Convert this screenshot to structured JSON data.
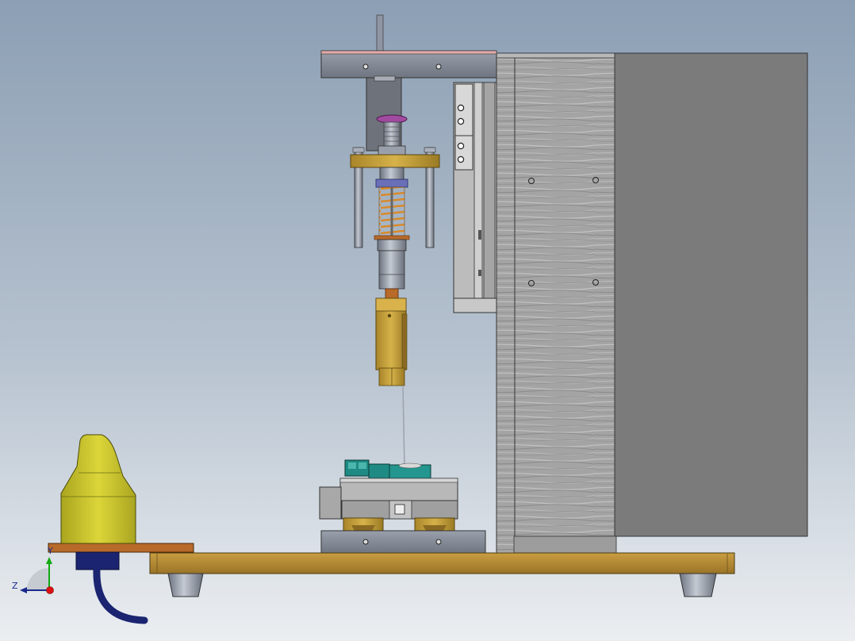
{
  "triad": {
    "y_label": "Y",
    "z_label": "Z"
  },
  "colors": {
    "background_top": "#8c9fb4",
    "background_bottom": "#ebeef1",
    "wood": "#b8903a",
    "wood_dark": "#8a6a22",
    "brass": "#c9a23a",
    "steel": "#8f96a3",
    "steel_dark": "#5f6570",
    "cabinet_grey": "#7b7b7b",
    "textured_panel": "#a2a2a2",
    "teal": "#1f8a84",
    "yellow_part": "#c9c42e",
    "navy_cable": "#1a2470",
    "copper": "#b86a2a",
    "pink_plate": "#e4a9a9",
    "purple_nut": "#a04aa0",
    "axis_x": "#d11",
    "axis_y": "#1a1",
    "axis_z": "#1a2a8a"
  }
}
